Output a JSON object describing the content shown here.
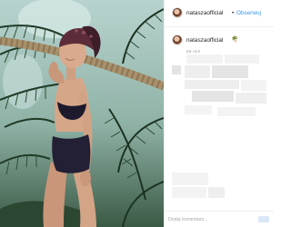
{
  "post": {
    "username": "nataszaofficial",
    "header_separator": "•",
    "follow_label": "Obserwuj",
    "caption_emoji": "🌴",
    "timestamp": "58 min"
  },
  "comment_box": {
    "placeholder": "Dodaj komentarz..."
  },
  "colors": {
    "link": "#3897f0",
    "text": "#262626",
    "muted": "#9a9a9a",
    "divider": "#efefef"
  },
  "icons": {
    "palm": "palm-tree-emoji"
  }
}
